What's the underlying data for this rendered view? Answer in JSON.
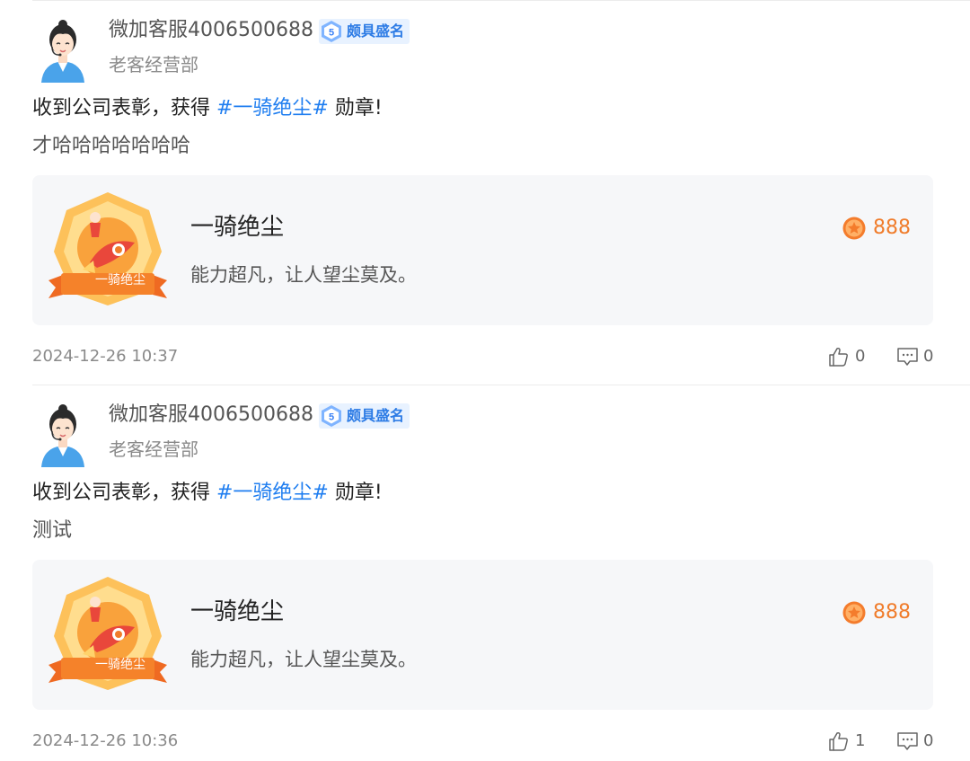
{
  "posts": [
    {
      "username": "微加客服4006500688",
      "level": {
        "number": "5",
        "label": "颇具盛名"
      },
      "department": "老客经营部",
      "award_prefix": "收到公司表彰，获得 ",
      "award_tag": "#一骑绝尘#",
      "award_suffix": " 勋章!",
      "message": "才哈哈哈哈哈哈哈",
      "medal": {
        "badge_label": "一骑绝尘",
        "title": "一骑绝尘",
        "description": "能力超凡，让人望尘莫及。",
        "points": "888"
      },
      "timestamp": "2024-12-26 10:37",
      "likes": "0",
      "comments": "0"
    },
    {
      "username": "微加客服4006500688",
      "level": {
        "number": "5",
        "label": "颇具盛名"
      },
      "department": "老客经营部",
      "award_prefix": "收到公司表彰，获得 ",
      "award_tag": "#一骑绝尘#",
      "award_suffix": " 勋章!",
      "message": "测试",
      "medal": {
        "badge_label": "一骑绝尘",
        "title": "一骑绝尘",
        "description": "能力超凡，让人望尘莫及。",
        "points": "888"
      },
      "timestamp": "2024-12-26 10:36",
      "likes": "1",
      "comments": "0"
    }
  ],
  "icons": {
    "avatar": "customer-service-avatar",
    "level": "level-shield-icon",
    "points": "points-coin-icon",
    "like": "thumbs-up-icon",
    "comment": "comment-icon"
  },
  "colors": {
    "tag": "#1e7df0",
    "points": "#f07c2b",
    "level_text": "#2c7be5",
    "card_bg": "#f6f7f9"
  }
}
